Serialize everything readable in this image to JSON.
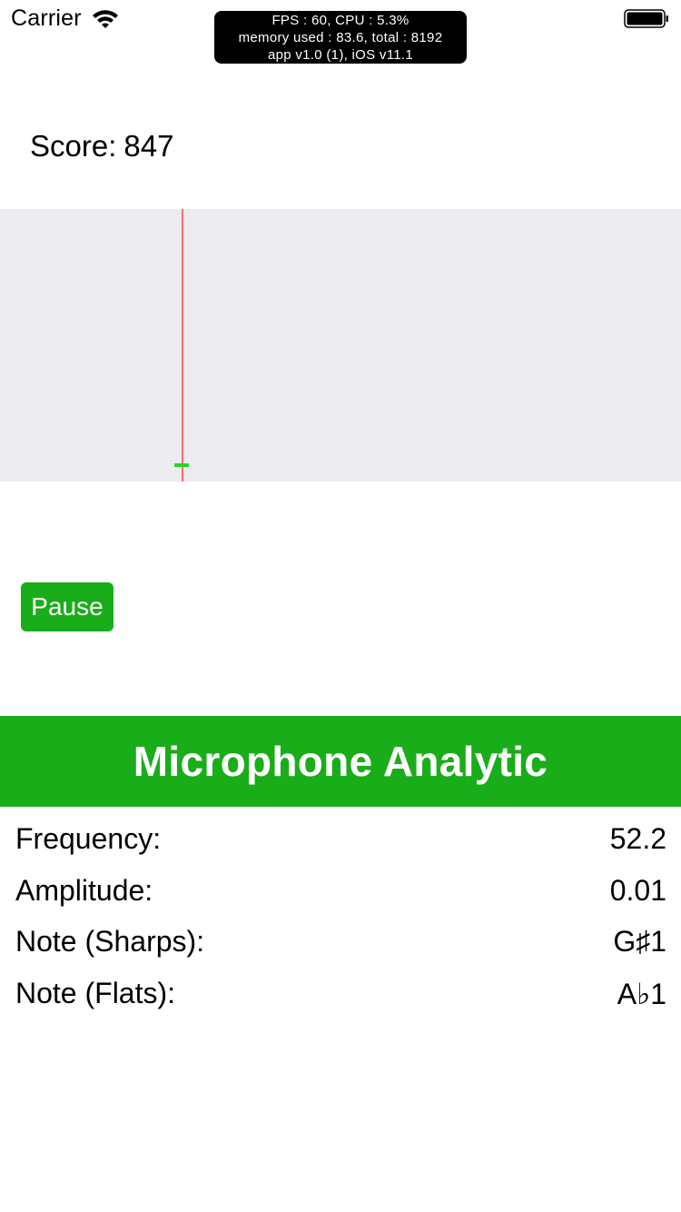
{
  "status_bar": {
    "carrier": "Carrier",
    "wifi_icon": "wifi-icon",
    "battery_icon": "battery-full-icon"
  },
  "debug_overlay": {
    "line1": "FPS : 60, CPU : 5.3%",
    "line2": "memory used : 83.6, total : 8192",
    "line3": "app v1.0 (1), iOS v11.1"
  },
  "score": {
    "label": "Score:",
    "value": "847"
  },
  "pitch_track": {
    "background_color": "#ebebf0",
    "playhead_color": "#ff6b6b",
    "marker_color": "#2bd42b"
  },
  "controls": {
    "pause_label": "Pause"
  },
  "analytic": {
    "title": "Microphone Analytic",
    "accent_color": "#1aad1a",
    "rows": [
      {
        "label": "Frequency:",
        "value": "52.2"
      },
      {
        "label": "Amplitude:",
        "value": "0.01"
      },
      {
        "label": "Note (Sharps):",
        "value": "G♯1"
      },
      {
        "label": "Note (Flats):",
        "value": "A♭1"
      }
    ]
  }
}
